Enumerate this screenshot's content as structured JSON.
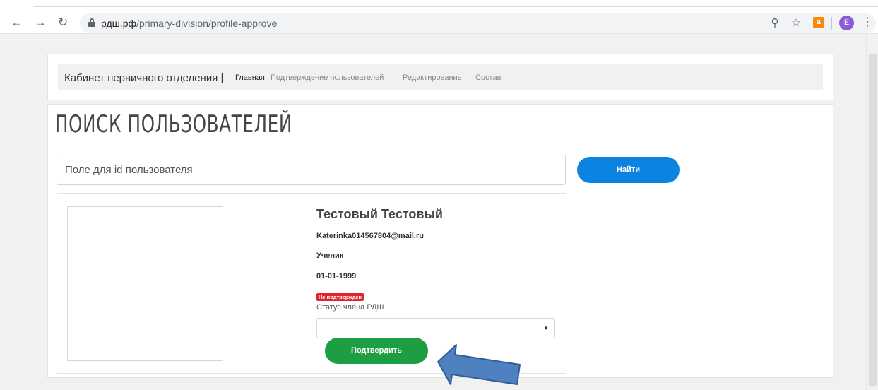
{
  "browser": {
    "url_host": "рдш.рф",
    "url_path": "/primary-division/profile-approve",
    "avatar_letter": "E",
    "extension_letter": "a"
  },
  "menu": {
    "title": "Кабинет первичного отделения |",
    "links": [
      "Главная",
      "Подтверждение пользователей",
      "Редактирование",
      "Состав"
    ],
    "active_index": 0
  },
  "search": {
    "title": "ПОИСК ПОЛЬЗОВАТЕЛЕЙ",
    "placeholder": "Поле для id пользователя",
    "button_label": "Найти"
  },
  "profile": {
    "name": "Тестовый Тестовый",
    "email": "Katerinka014567804@mail.ru",
    "role": "Ученик",
    "birthdate": "01-01-1999",
    "badge": "Не подтвержден",
    "status_label": "Статус члена РДШ",
    "status_value": "",
    "confirm_label": "Подтвердить"
  },
  "colors": {
    "find_button": "#0a84e0",
    "confirm_button": "#1e9e42",
    "badge": "#e0242b",
    "arrow": "#4f80c0"
  }
}
